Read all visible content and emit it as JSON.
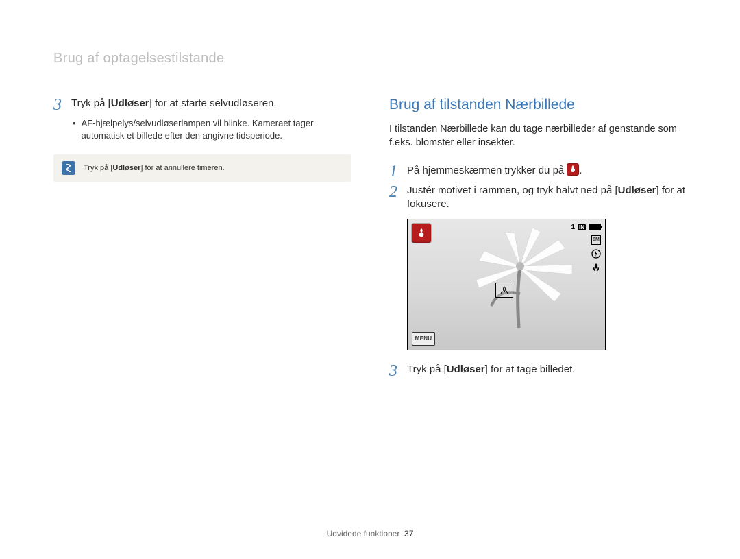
{
  "header": {
    "breadcrumb": "Brug af optagelsestilstande"
  },
  "left": {
    "step3_prefix": "Tryk på [",
    "step3_bold": "Udløser",
    "step3_suffix": "] for at starte selvudløseren.",
    "step3_num": "3",
    "bullet": "AF-hjælpelys/selvudløserlampen vil blinke. Kameraet tager automatisk et billede efter den angivne tidsperiode.",
    "note_prefix": "Tryk på [",
    "note_bold": "Udløser",
    "note_suffix": "] for at annullere timeren."
  },
  "right": {
    "title": "Brug af tilstanden Nærbillede",
    "intro": "I tilstanden Nærbillede kan du tage nærbilleder af genstande som f.eks. blomster eller insekter.",
    "step1_num": "1",
    "step1_prefix": "På hjemmeskærmen trykker du på ",
    "step1_suffix": ".",
    "step2_num": "2",
    "step2_prefix": "Justér motivet i rammen, og tryk halvt ned på [",
    "step2_bold": "Udløser",
    "step2_suffix": "] for at fokusere.",
    "step3_num": "3",
    "step3_prefix": "Tryk på [",
    "step3_bold": "Udløser",
    "step3_suffix": "] for at tage billedet."
  },
  "screen": {
    "menu": "MENU",
    "shots": "1",
    "storage": "IN",
    "resolution": "8M"
  },
  "footer": {
    "section": "Udvidede funktioner",
    "page": "37"
  }
}
